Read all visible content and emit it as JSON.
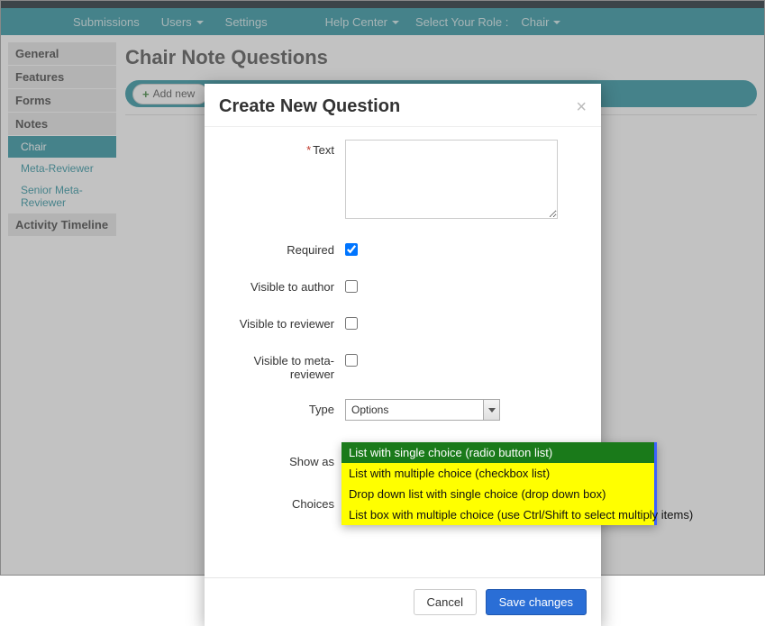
{
  "topbar": {
    "items": [
      "Submissions",
      "Users",
      "Settings"
    ],
    "help": "Help Center",
    "role_label": "Select Your Role :",
    "role_value": "Chair"
  },
  "sidebar": {
    "general": "General",
    "features": "Features",
    "forms": "Forms",
    "notes": "Notes",
    "notes_children": [
      "Chair",
      "Meta-Reviewer",
      "Senior Meta-Reviewer"
    ],
    "activity": "Activity Timeline"
  },
  "page": {
    "title": "Chair Note Questions",
    "add_btn": "Add new"
  },
  "modal": {
    "title": "Create New Question",
    "labels": {
      "text": "Text",
      "required": "Required",
      "vis_author": "Visible to author",
      "vis_reviewer": "Visible to reviewer",
      "vis_meta": "Visible to meta-reviewer",
      "type": "Type",
      "show_as": "Show as",
      "choices": "Choices"
    },
    "type_value": "Options",
    "show_as_value": "List with single choice (radio b",
    "required_checked": true,
    "footer": {
      "cancel": "Cancel",
      "save": "Save changes"
    }
  },
  "dropdown": {
    "options": [
      "List with single choice (radio button list)",
      "List with multiple choice (checkbox list)",
      "Drop down list with single choice (drop down box)",
      "List box with multiple choice (use Ctrl/Shift to select multiply items)"
    ],
    "selected_index": 0
  }
}
